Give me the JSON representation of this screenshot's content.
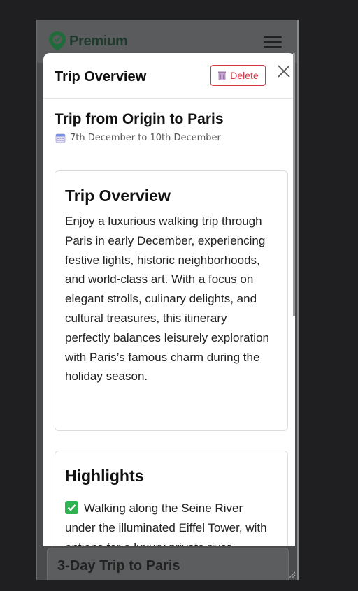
{
  "app": {
    "logo_text": "Premium",
    "bottom_card_title": "3-Day Trip to Paris"
  },
  "modal": {
    "title": "Trip Overview",
    "delete_label": "Delete",
    "trip_title": "Trip from Origin to Paris",
    "trip_dates": "7th December to 10th December"
  },
  "cards": [
    {
      "heading": "Trip Overview",
      "body": "Enjoy a luxurious walking trip through Paris in early December, experiencing festive lights, historic neighborhoods, and world-class art. With a focus on elegant strolls, culinary delights, and cultural treasures, this itinerary perfectly balances leisurely exploration with Paris’s famous charm during the holiday season."
    },
    {
      "heading": "Highlights",
      "body": "Walking along the Seine River under the illuminated Eiffel Tower, with options for a luxury private river"
    }
  ],
  "colors": {
    "accent_danger": "#dc3545",
    "logo_green": "#1f6b3a",
    "check_green": "#2fb24f"
  },
  "icons": [
    "map-pin-logo-icon",
    "hamburger-menu-icon",
    "trash-icon",
    "close-icon",
    "calendar-icon",
    "checkmark-icon"
  ]
}
